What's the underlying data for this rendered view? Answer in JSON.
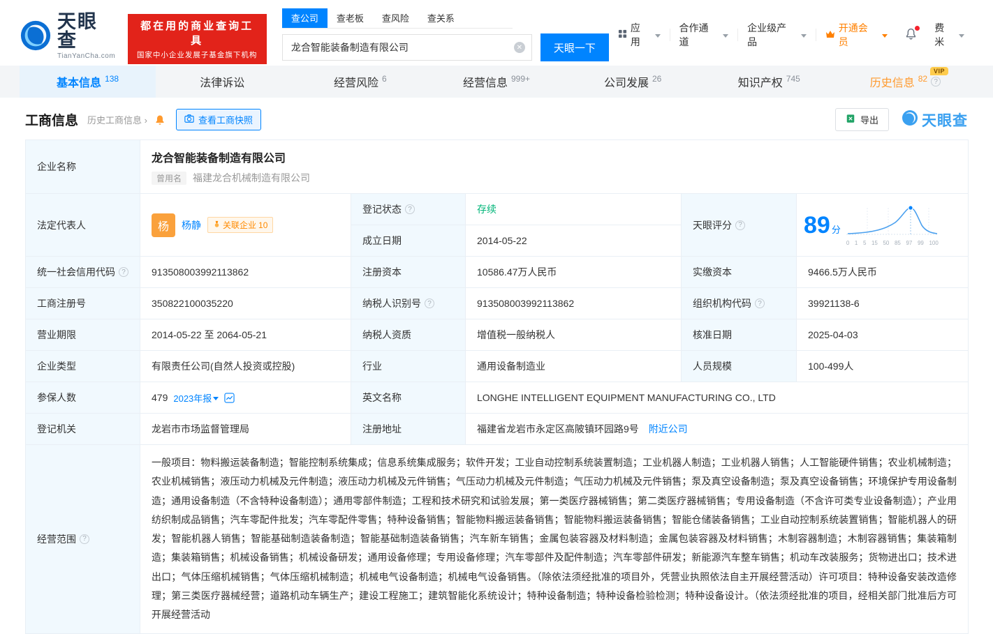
{
  "brand": {
    "name": "天眼查",
    "domain": "TianYanCha.com",
    "slogan_line1": "都在用的商业查询工具",
    "slogan_line2": "国家中小企业发展子基金旗下机构",
    "watermark": "天眼查"
  },
  "search": {
    "tabs": [
      {
        "label": "查公司"
      },
      {
        "label": "查老板"
      },
      {
        "label": "查风险"
      },
      {
        "label": "查关系"
      }
    ],
    "value": "龙合智能装备制造有限公司",
    "button": "天眼一下"
  },
  "header_menu": {
    "apps": "应用",
    "partner": "合作通道",
    "enterprise": "企业级产品",
    "vip": "开通会员",
    "user": "费米"
  },
  "nav_tabs": [
    {
      "label": "基本信息",
      "count": "138"
    },
    {
      "label": "法律诉讼",
      "count": ""
    },
    {
      "label": "经营风险",
      "count": "6"
    },
    {
      "label": "经营信息",
      "count": "999+"
    },
    {
      "label": "公司发展",
      "count": "26"
    },
    {
      "label": "知识产权",
      "count": "745"
    },
    {
      "label": "历史信息",
      "count": "82",
      "vip": "VIP"
    }
  ],
  "section": {
    "title": "工商信息",
    "history_link": "历史工商信息 ›",
    "snapshot_button": "查看工商快照",
    "export_button": "导出"
  },
  "labels": {
    "company_name": "企业名称",
    "legal_rep": "法定代表人",
    "reg_status": "登记状态",
    "establish_date": "成立日期",
    "score": "天眼评分",
    "credit_code": "统一社会信用代码",
    "reg_capital": "注册资本",
    "paid_capital": "实缴资本",
    "reg_number": "工商注册号",
    "taxpayer_id": "纳税人识别号",
    "org_code": "组织机构代码",
    "business_term": "营业期限",
    "taxpayer_quality": "纳税人资质",
    "approval_date": "核准日期",
    "company_type": "企业类型",
    "industry": "行业",
    "staff_size": "人员规模",
    "insured_count": "参保人数",
    "english_name": "英文名称",
    "reg_authority": "登记机关",
    "reg_address": "注册地址",
    "business_scope": "经营范围"
  },
  "info": {
    "company_name": "龙合智能装备制造有限公司",
    "former_name_tag": "曾用名",
    "former_name": "福建龙合机械制造有限公司",
    "legal_rep_avatar": "杨",
    "legal_rep_name": "杨静",
    "related_label": "关联企业",
    "related_count": "10",
    "reg_status": "存续",
    "establish_date": "2014-05-22",
    "credit_code": "913508003992113862",
    "reg_capital": "10586.47万人民币",
    "paid_capital": "9466.5万人民币",
    "reg_number": "350822100035220",
    "taxpayer_id": "913508003992113862",
    "org_code": "39921138-6",
    "business_term": "2014-05-22 至 2064-05-21",
    "taxpayer_quality": "增值税一般纳税人",
    "approval_date": "2025-04-03",
    "company_type": "有限责任公司(自然人投资或控股)",
    "industry": "通用设备制造业",
    "staff_size": "100-499人",
    "insured_count": "479",
    "annual_report": "2023年报",
    "english_name": "LONGHE INTELLIGENT EQUIPMENT MANUFACTURING CO., LTD",
    "reg_authority": "龙岩市市场监督管理局",
    "reg_address": "福建省龙岩市永定区高陂镇环园路9号",
    "nearby_link": "附近公司",
    "business_scope": "一般项目：物料搬运装备制造；智能控制系统集成；信息系统集成服务；软件开发；工业自动控制系统装置制造；工业机器人制造；工业机器人销售；人工智能硬件销售；农业机械制造；农业机械销售；液压动力机械及元件制造；液压动力机械及元件销售；气压动力机械及元件制造；气压动力机械及元件销售；泵及真空设备制造；泵及真空设备销售；环境保护专用设备制造；通用设备制造（不含特种设备制造）；通用零部件制造；工程和技术研究和试验发展；第一类医疗器械销售；第二类医疗器械销售；专用设备制造（不含许可类专业设备制造）；产业用纺织制成品销售；汽车零配件批发；汽车零配件零售；特种设备销售；智能物料搬运装备销售；智能物料搬运装备销售；智能仓储装备销售；工业自动控制系统装置销售；智能机器人的研发；智能机器人销售；智能基础制造装备制造；智能基础制造装备销售；汽车新车销售；金属包装容器及材料制造；金属包装容器及材料销售；木制容器制造；木制容器销售；集装箱制造；集装箱销售；机械设备销售；机械设备研发；通用设备修理；专用设备修理；汽车零部件及配件制造；汽车零部件研发；新能源汽车整车销售；机动车改装服务；货物进出口；技术进出口；气体压缩机械销售；气体压缩机械制造；机械电气设备制造；机械电气设备销售。（除依法须经批准的项目外，凭营业执照依法自主开展经营活动）许可项目：特种设备安装改造修理；第三类医疗器械经营；道路机动车辆生产；建设工程施工；建筑智能化系统设计；特种设备制造；特种设备检验检测；特种设备设计。（依法须经批准的项目，经相关部门批准后方可开展经营活动"
  },
  "score": {
    "value": "89",
    "unit": "分",
    "ticks": [
      "0",
      "1",
      "5",
      "15",
      "50",
      "85",
      "97",
      "99",
      "100"
    ]
  }
}
